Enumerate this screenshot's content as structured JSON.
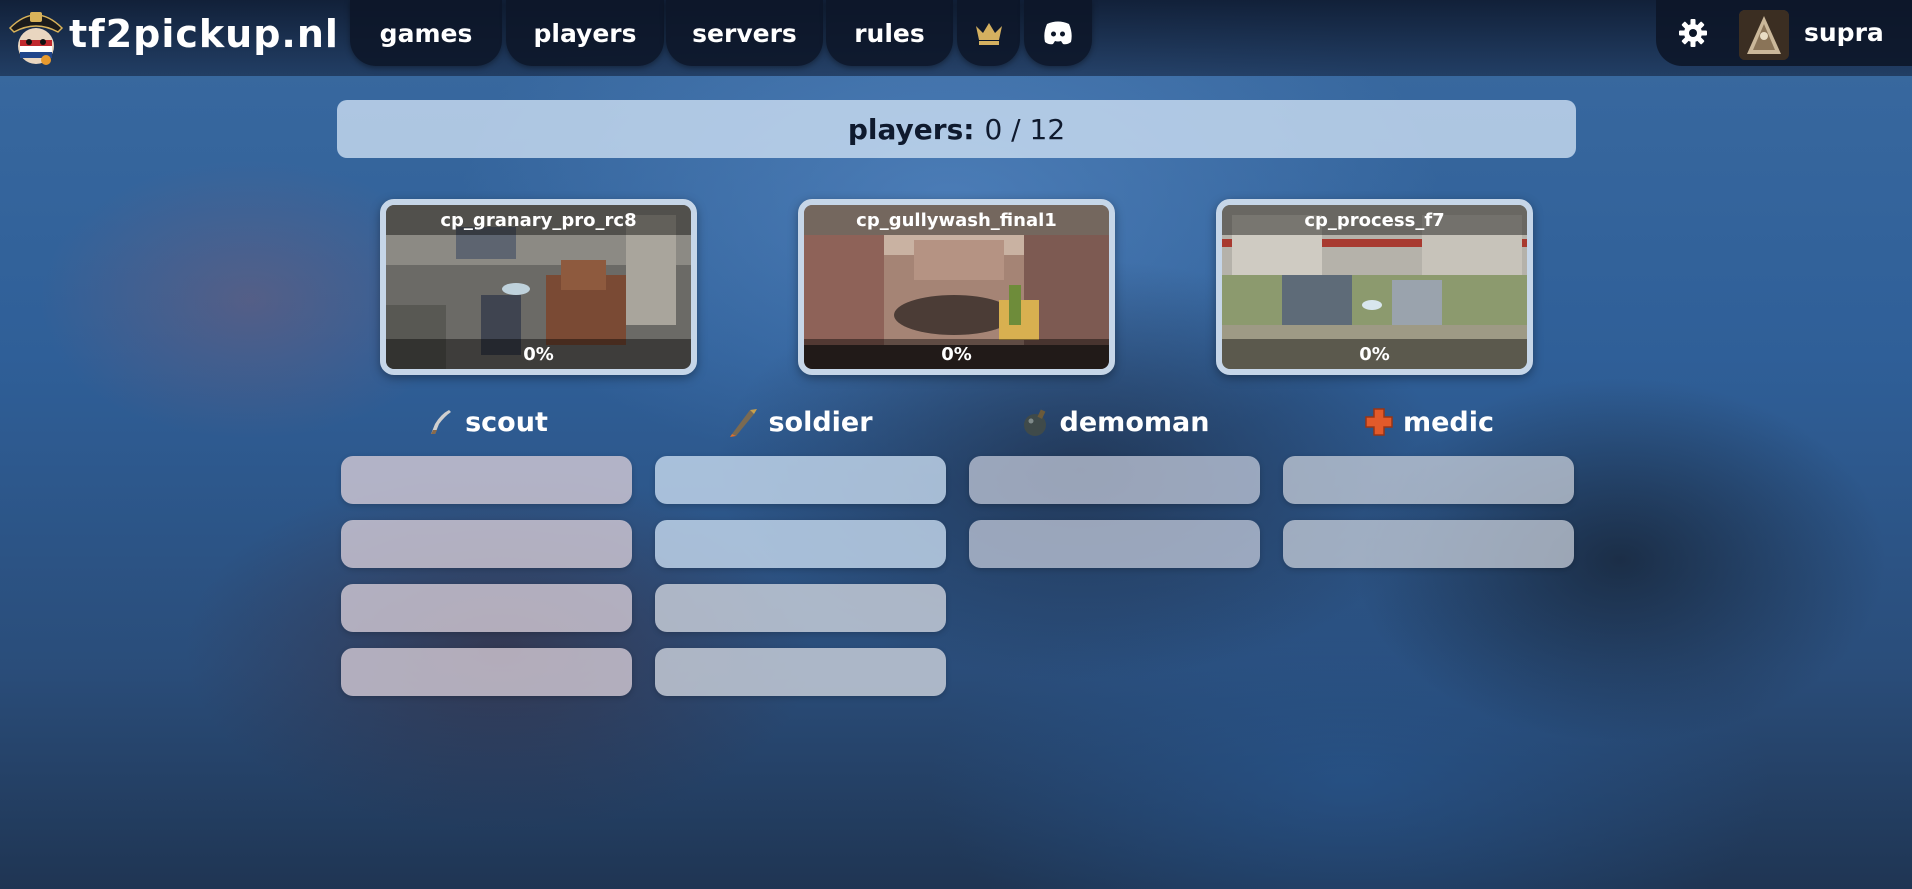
{
  "brand": {
    "name": "tf2pickup.nl",
    "logo_icon": "mascot-logo-icon"
  },
  "nav": {
    "items": [
      {
        "label": "games"
      },
      {
        "label": "players"
      },
      {
        "label": "servers"
      },
      {
        "label": "rules"
      }
    ],
    "hall_of_fame_icon": "crown-icon",
    "discord_icon": "discord-icon"
  },
  "user": {
    "settings_icon": "gear-icon",
    "name": "supra"
  },
  "queue": {
    "players_label": "players:",
    "players_count": "0 / 12"
  },
  "maps": [
    {
      "name": "cp_granary_pro_rc8",
      "vote_percent": "0%"
    },
    {
      "name": "cp_gullywash_final1",
      "vote_percent": "0%"
    },
    {
      "name": "cp_process_f7",
      "vote_percent": "0%"
    }
  ],
  "classes": [
    {
      "name": "scout",
      "icon": "scout-icon",
      "slots": 4
    },
    {
      "name": "soldier",
      "icon": "soldier-icon",
      "slots": 4
    },
    {
      "name": "demoman",
      "icon": "demoman-icon",
      "slots": 2
    },
    {
      "name": "medic",
      "icon": "medic-icon",
      "slots": 2
    }
  ],
  "colors": {
    "nav_bg": "#0c1628",
    "panel": "#c8dcf0",
    "text_dark": "#0f1a2e",
    "crown": "#d4b060",
    "medic_cross": "#e25a2a"
  }
}
